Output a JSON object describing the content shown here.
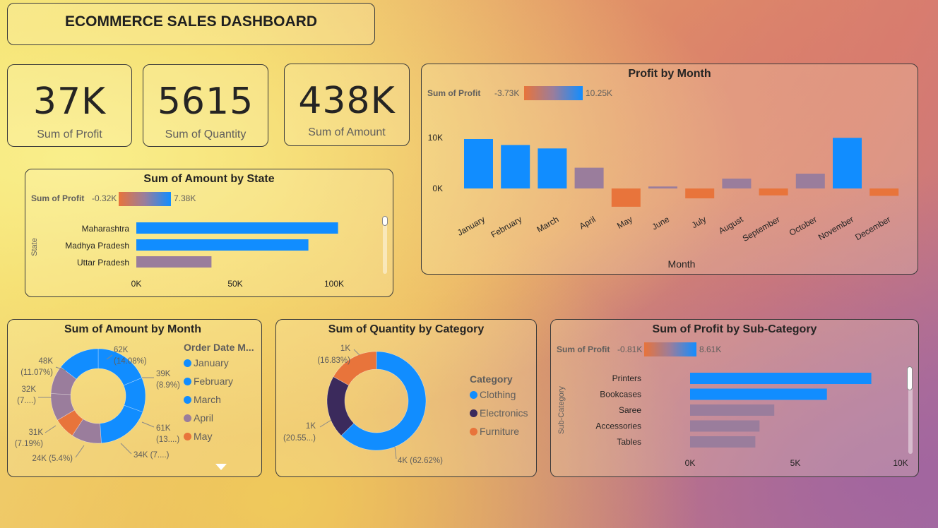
{
  "dashboard": {
    "title": "ECOMMERCE SALES DASHBOARD"
  },
  "kpis": [
    {
      "value": "37K",
      "label": "Sum of Profit"
    },
    {
      "value": "5615",
      "label": "Sum of Quantity"
    },
    {
      "value": "438K",
      "label": "Sum of Amount"
    }
  ],
  "colors": {
    "positive": "#118dff",
    "neutral": "#9a7d9c",
    "negative": "#e8743b",
    "dark": "#3b2a5c"
  },
  "chart_data": [
    {
      "id": "state",
      "type": "bar",
      "title": "Sum of Amount by State",
      "ylabel": "State",
      "legend": {
        "title": "Sum of Profit",
        "min": "-0.32K",
        "max": "7.38K"
      },
      "categories": [
        "Maharashtra",
        "Madhya Pradesh",
        "Uttar Pradesh"
      ],
      "values": [
        102000,
        87000,
        38000
      ],
      "profit_color": [
        "positive",
        "positive",
        "neutral"
      ],
      "xticks": [
        "0K",
        "50K",
        "100K"
      ],
      "xlim": [
        0,
        100000
      ]
    },
    {
      "id": "month_profit",
      "type": "bar",
      "title": "Profit by Month",
      "xlabel": "Month",
      "legend": {
        "title": "Sum of Profit",
        "min": "-3.73K",
        "max": "10.25K"
      },
      "categories": [
        "January",
        "February",
        "March",
        "April",
        "May",
        "June",
        "July",
        "August",
        "September",
        "October",
        "November",
        "December"
      ],
      "values": [
        10000,
        8800,
        8100,
        4200,
        -3700,
        400,
        -2000,
        2000,
        -1400,
        3000,
        10250,
        -1500
      ],
      "profit_color": [
        "positive",
        "positive",
        "positive",
        "neutral",
        "negative",
        "neutral",
        "negative",
        "neutral",
        "negative",
        "neutral",
        "positive",
        "negative"
      ],
      "yticks": [
        "10K",
        "0K"
      ]
    },
    {
      "id": "amount_month",
      "type": "pie",
      "title": "Sum of Amount by Month",
      "legend_title": "Order Date M...",
      "legend": [
        "January",
        "February",
        "March",
        "April",
        "May"
      ],
      "legend_colors": [
        "positive",
        "positive",
        "positive",
        "neutral",
        "negative"
      ],
      "values": [
        62,
        39,
        61,
        34,
        24,
        31,
        32,
        48
      ],
      "slice_colors": [
        "positive",
        "positive",
        "positive",
        "neutral",
        "negative",
        "neutral",
        "neutral",
        "positive"
      ],
      "data_labels": [
        {
          "value": "62K",
          "pct": "(14.08%)"
        },
        {
          "value": "39K",
          "pct": "(8.9%)"
        },
        {
          "value": "61K",
          "pct": "(13....)"
        },
        {
          "value": "34K",
          "pct": "(7....)"
        },
        {
          "value": "24K",
          "pct": "(5.4%)"
        },
        {
          "value": "31K",
          "pct": "(7.19%)"
        },
        {
          "value": "32K",
          "pct": "(7....)"
        },
        {
          "value": "48K",
          "pct": "(11.07%)"
        }
      ]
    },
    {
      "id": "qty_category",
      "type": "pie",
      "title": "Sum of Quantity by Category",
      "legend_title": "Category",
      "legend": [
        "Clothing",
        "Electronics",
        "Furniture"
      ],
      "legend_colors": [
        "positive",
        "dark",
        "negative"
      ],
      "values": [
        62.62,
        20.55,
        16.83
      ],
      "slice_colors": [
        "positive",
        "dark",
        "negative"
      ],
      "data_labels": [
        {
          "value": "4K",
          "pct": "(62.62%)"
        },
        {
          "value": "1K",
          "pct": "(20.55...)"
        },
        {
          "value": "1K",
          "pct": "(16.83%)"
        }
      ]
    },
    {
      "id": "subcat",
      "type": "bar",
      "title": "Sum of Profit by Sub-Category",
      "ylabel": "Sub-Category",
      "legend": {
        "title": "Sum of Profit",
        "min": "-0.81K",
        "max": "8.61K"
      },
      "categories": [
        "Printers",
        "Bookcases",
        "Saree",
        "Accessories",
        "Tables"
      ],
      "values": [
        8610,
        6500,
        4000,
        3300,
        3100
      ],
      "profit_color": [
        "positive",
        "positive",
        "neutral",
        "neutral",
        "neutral"
      ],
      "xticks": [
        "0K",
        "5K",
        "10K"
      ],
      "xlim": [
        0,
        10000
      ]
    }
  ]
}
